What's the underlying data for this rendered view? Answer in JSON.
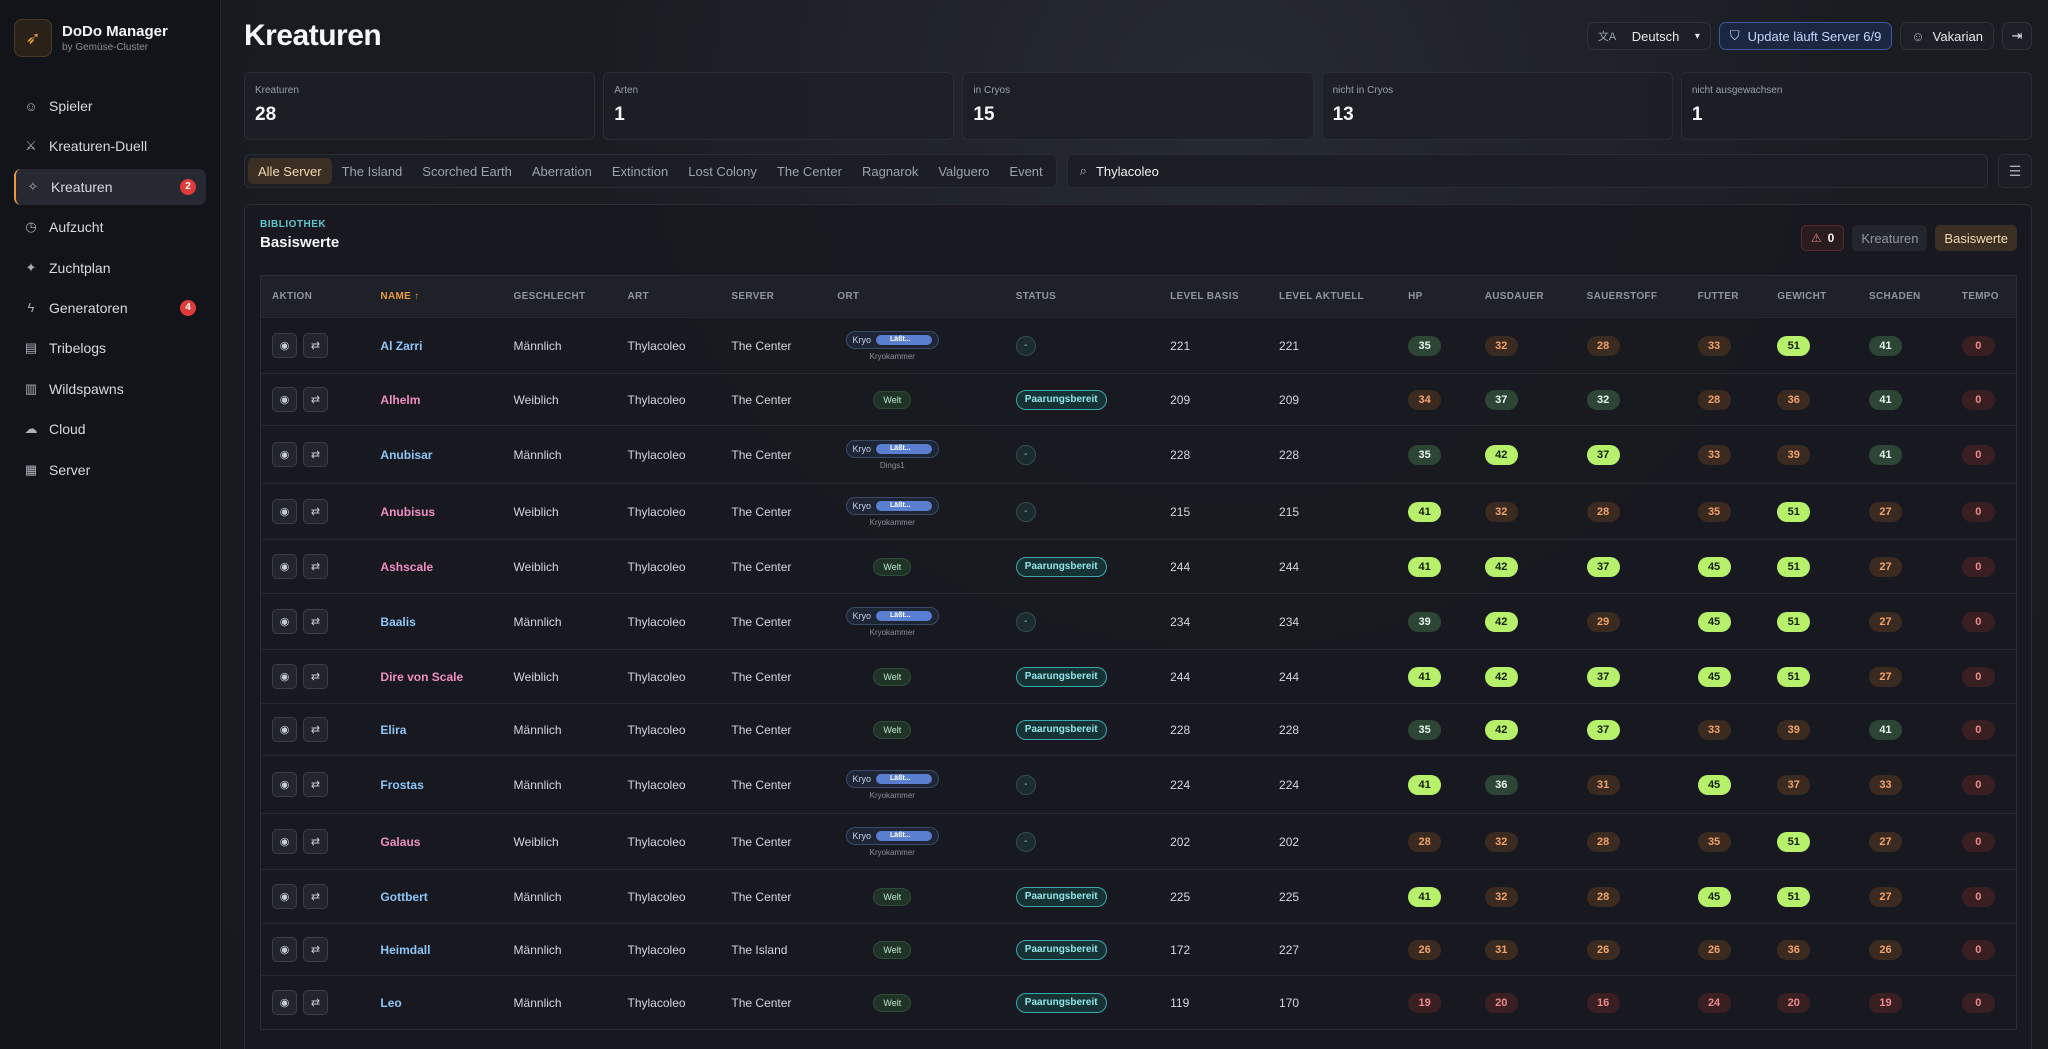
{
  "app": {
    "title": "DoDo Manager",
    "subtitle": "by Gemüse-Cluster"
  },
  "nav": [
    {
      "label": "Spieler",
      "icon": "user-icon",
      "glyph": "☺",
      "badge": ""
    },
    {
      "label": "Kreaturen-Duell",
      "icon": "swords-icon",
      "glyph": "⚔",
      "badge": ""
    },
    {
      "label": "Kreaturen",
      "icon": "sparkle-icon",
      "glyph": "✧",
      "badge": "2",
      "active": true
    },
    {
      "label": "Aufzucht",
      "icon": "clock-icon",
      "glyph": "◷",
      "badge": ""
    },
    {
      "label": "Zuchtplan",
      "icon": "sparkle-icon",
      "glyph": "✦",
      "badge": ""
    },
    {
      "label": "Generatoren",
      "icon": "lightning-icon",
      "glyph": "ϟ",
      "badge": "4"
    },
    {
      "label": "Tribelogs",
      "icon": "log-icon",
      "glyph": "▤",
      "badge": ""
    },
    {
      "label": "Wildspawns",
      "icon": "map-icon",
      "glyph": "▥",
      "badge": ""
    },
    {
      "label": "Cloud",
      "icon": "cloud-icon",
      "glyph": "☁",
      "badge": ""
    },
    {
      "label": "Server",
      "icon": "server-icon",
      "glyph": "▦",
      "badge": ""
    }
  ],
  "header": {
    "title": "Kreaturen",
    "language": "Deutsch",
    "update": "Update läuft Server 6/9",
    "user": "Vakarian"
  },
  "stats": [
    {
      "label": "Kreaturen",
      "value": "28"
    },
    {
      "label": "Arten",
      "value": "1"
    },
    {
      "label": "in Cryos",
      "value": "15"
    },
    {
      "label": "nicht in Cryos",
      "value": "13"
    },
    {
      "label": "nicht ausgewachsen",
      "value": "1"
    }
  ],
  "server_tabs": [
    "Alle Server",
    "The Island",
    "Scorched Earth",
    "Aberration",
    "Extinction",
    "Lost Colony",
    "The Center",
    "Ragnarok",
    "Valguero",
    "Event"
  ],
  "search": {
    "value": "Thylacoleo"
  },
  "card": {
    "eyebrow": "BIBLIOTHEK",
    "title": "Basiswerte",
    "warn_count": "0",
    "seg_kreaturen": "Kreaturen",
    "seg_basiswerte": "Basiswerte"
  },
  "columns": [
    "AKTION",
    "NAME ↑",
    "GESCHLECHT",
    "ART",
    "SERVER",
    "ORT",
    "STATUS",
    "LEVEL BASIS",
    "LEVEL AKTUELL",
    "HP",
    "AUSDAUER",
    "SAUERSTOFF",
    "FUTTER",
    "GEWICHT",
    "SCHADEN",
    "TEMPO"
  ],
  "kryo_label": "Kryo",
  "kryo_bar": "Läßt...",
  "welt_label": "Welt",
  "status_pair": "Paarungsbereit",
  "status_none": "-",
  "rows": [
    {
      "name": "Al Zarri",
      "g": "Männlich",
      "art": "Thylacoleo",
      "server": "The Center",
      "ort": "kryo",
      "ort_sub": "Kryokammer",
      "status": "-",
      "lb": "221",
      "la": "221",
      "vals": [
        "35",
        "32",
        "28",
        "33",
        "51",
        "41",
        "0"
      ],
      "cls": [
        "green",
        "orange",
        "orange",
        "orange",
        "lime",
        "green",
        "red"
      ]
    },
    {
      "name": "Alhelm",
      "g": "Weiblich",
      "art": "Thylacoleo",
      "server": "The Center",
      "ort": "welt",
      "ort_sub": "",
      "status": "pair",
      "lb": "209",
      "la": "209",
      "vals": [
        "34",
        "37",
        "32",
        "28",
        "36",
        "41",
        "0"
      ],
      "cls": [
        "orange",
        "green",
        "green",
        "orange",
        "orange",
        "green",
        "red"
      ]
    },
    {
      "name": "Anubisar",
      "g": "Männlich",
      "art": "Thylacoleo",
      "server": "The Center",
      "ort": "kryo",
      "ort_sub": "Dings1",
      "status": "-",
      "lb": "228",
      "la": "228",
      "vals": [
        "35",
        "42",
        "37",
        "33",
        "39",
        "41",
        "0"
      ],
      "cls": [
        "green",
        "lime",
        "lime",
        "orange",
        "orange",
        "green",
        "red"
      ]
    },
    {
      "name": "Anubisus",
      "g": "Weiblich",
      "art": "Thylacoleo",
      "server": "The Center",
      "ort": "kryo",
      "ort_sub": "Kryokammer",
      "status": "-",
      "lb": "215",
      "la": "215",
      "vals": [
        "41",
        "32",
        "28",
        "35",
        "51",
        "27",
        "0"
      ],
      "cls": [
        "lime",
        "orange",
        "orange",
        "orange",
        "lime",
        "orange",
        "red"
      ]
    },
    {
      "name": "Ashscale",
      "g": "Weiblich",
      "art": "Thylacoleo",
      "server": "The Center",
      "ort": "welt",
      "ort_sub": "",
      "status": "pair",
      "lb": "244",
      "la": "244",
      "vals": [
        "41",
        "42",
        "37",
        "45",
        "51",
        "27",
        "0"
      ],
      "cls": [
        "lime",
        "lime",
        "lime",
        "lime",
        "lime",
        "orange",
        "red"
      ]
    },
    {
      "name": "Baalis",
      "g": "Männlich",
      "art": "Thylacoleo",
      "server": "The Center",
      "ort": "kryo",
      "ort_sub": "Kryokammer",
      "status": "-",
      "lb": "234",
      "la": "234",
      "vals": [
        "39",
        "42",
        "29",
        "45",
        "51",
        "27",
        "0"
      ],
      "cls": [
        "green",
        "lime",
        "orange",
        "lime",
        "lime",
        "orange",
        "red"
      ]
    },
    {
      "name": "Dire von Scale",
      "g": "Weiblich",
      "art": "Thylacoleo",
      "server": "The Center",
      "ort": "welt",
      "ort_sub": "",
      "status": "pair",
      "lb": "244",
      "la": "244",
      "vals": [
        "41",
        "42",
        "37",
        "45",
        "51",
        "27",
        "0"
      ],
      "cls": [
        "lime",
        "lime",
        "lime",
        "lime",
        "lime",
        "orange",
        "red"
      ]
    },
    {
      "name": "Elira",
      "g": "Männlich",
      "art": "Thylacoleo",
      "server": "The Center",
      "ort": "welt",
      "ort_sub": "",
      "status": "pair",
      "lb": "228",
      "la": "228",
      "vals": [
        "35",
        "42",
        "37",
        "33",
        "39",
        "41",
        "0"
      ],
      "cls": [
        "green",
        "lime",
        "lime",
        "orange",
        "orange",
        "green",
        "red"
      ]
    },
    {
      "name": "Frostas",
      "g": "Männlich",
      "art": "Thylacoleo",
      "server": "The Center",
      "ort": "kryo",
      "ort_sub": "Kryokammer",
      "status": "-",
      "lb": "224",
      "la": "224",
      "vals": [
        "41",
        "36",
        "31",
        "45",
        "37",
        "33",
        "0"
      ],
      "cls": [
        "lime",
        "green",
        "orange",
        "lime",
        "orange",
        "orange",
        "red"
      ]
    },
    {
      "name": "Galaus",
      "g": "Weiblich",
      "art": "Thylacoleo",
      "server": "The Center",
      "ort": "kryo",
      "ort_sub": "Kryokammer",
      "status": "-",
      "lb": "202",
      "la": "202",
      "vals": [
        "28",
        "32",
        "28",
        "35",
        "51",
        "27",
        "0"
      ],
      "cls": [
        "orange",
        "orange",
        "orange",
        "orange",
        "lime",
        "orange",
        "red"
      ]
    },
    {
      "name": "Gottbert",
      "g": "Männlich",
      "art": "Thylacoleo",
      "server": "The Center",
      "ort": "welt",
      "ort_sub": "",
      "status": "pair",
      "lb": "225",
      "la": "225",
      "vals": [
        "41",
        "32",
        "28",
        "45",
        "51",
        "27",
        "0"
      ],
      "cls": [
        "lime",
        "orange",
        "orange",
        "lime",
        "lime",
        "orange",
        "red"
      ]
    },
    {
      "name": "Heimdall",
      "g": "Männlich",
      "art": "Thylacoleo",
      "server": "The Island",
      "ort": "welt",
      "ort_sub": "",
      "status": "pair",
      "lb": "172",
      "la": "227",
      "vals": [
        "26",
        "31",
        "26",
        "26",
        "36",
        "26",
        "0"
      ],
      "cls": [
        "orange",
        "orange",
        "orange",
        "orange",
        "orange",
        "orange",
        "red"
      ]
    },
    {
      "name": "Leo",
      "g": "Männlich",
      "art": "Thylacoleo",
      "server": "The Center",
      "ort": "welt",
      "ort_sub": "",
      "status": "pair",
      "lb": "119",
      "la": "170",
      "vals": [
        "19",
        "20",
        "16",
        "24",
        "20",
        "19",
        "0"
      ],
      "cls": [
        "red",
        "red",
        "red",
        "red",
        "red",
        "red",
        "red"
      ]
    }
  ]
}
